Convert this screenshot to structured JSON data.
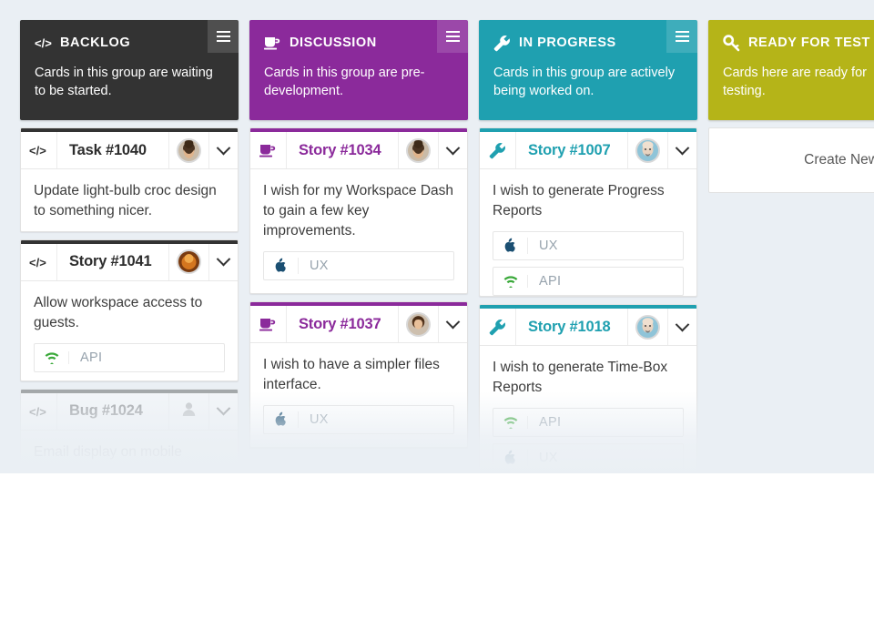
{
  "board": {
    "background_color": "#eaeff4",
    "columns": [
      {
        "id": "backlog",
        "title": "BACKLOG",
        "description": "Cards in this group are waiting to be started.",
        "color": "#333333",
        "icon": "code-icon",
        "menu_icon": "hamburger-icon",
        "cards": [
          {
            "icon": "code-icon",
            "title": "Task #1040",
            "avatar": "avatar-beard-man",
            "chevron": "chevron-down-icon",
            "text": "Update light-bulb croc design to something nicer.",
            "tags": []
          },
          {
            "icon": "code-icon",
            "title": "Story #1041",
            "avatar": "avatar-orange-person",
            "chevron": "chevron-down-icon",
            "text": "Allow workspace access to guests.",
            "tags": [
              {
                "label": "API",
                "icon": "wifi-icon",
                "color": "#3aa93a"
              }
            ]
          },
          {
            "icon": "code-icon",
            "title": "Bug #1024",
            "avatar": "user-placeholder-icon",
            "chevron": "chevron-down-icon",
            "text": "Email display on mobile",
            "tags": []
          }
        ]
      },
      {
        "id": "discussion",
        "title": "DISCUSSION",
        "description": "Cards in this group are pre-development.",
        "color": "#8b2a9b",
        "icon": "coffee-cup-icon",
        "menu_icon": "hamburger-icon",
        "cards": [
          {
            "icon": "coffee-cup-icon",
            "title": "Story #1034",
            "avatar": "avatar-beard-man",
            "chevron": "chevron-down-icon",
            "text": "I wish for my Workspace Dash to gain a few key improvements.",
            "tags": [
              {
                "label": "UX",
                "icon": "apple-icon",
                "color": "#1b4f72"
              }
            ]
          },
          {
            "icon": "coffee-cup-icon",
            "title": "Story #1037",
            "avatar": "avatar-woman",
            "chevron": "chevron-down-icon",
            "text": "I wish to have a simpler files interface.",
            "tags": [
              {
                "label": "UX",
                "icon": "apple-icon",
                "color": "#1b4f72"
              }
            ]
          }
        ]
      },
      {
        "id": "in-progress",
        "title": "IN PROGRESS",
        "description": "Cards in this group are actively being worked on.",
        "color": "#1fa0b0",
        "icon": "wrench-icon",
        "menu_icon": "hamburger-icon",
        "cards": [
          {
            "icon": "wrench-icon",
            "title": "Story #1007",
            "avatar": "avatar-bald-man",
            "chevron": "chevron-down-icon",
            "text": "I wish to generate Progress Reports",
            "tags": [
              {
                "label": "UX",
                "icon": "apple-icon",
                "color": "#1b4f72"
              },
              {
                "label": "API",
                "icon": "wifi-icon",
                "color": "#3aa93a"
              }
            ]
          },
          {
            "icon": "wrench-icon",
            "title": "Story #1018",
            "avatar": "avatar-bald-man",
            "chevron": "chevron-down-icon",
            "text": "I wish to generate Time-Box Reports",
            "tags": [
              {
                "label": "API",
                "icon": "wifi-icon",
                "color": "#3aa93a"
              },
              {
                "label": "UX",
                "icon": "apple-icon",
                "color": "#1b4f72"
              }
            ]
          }
        ]
      },
      {
        "id": "ready-for-test",
        "title": "READY FOR TEST",
        "description": "Cards here are ready for testing.",
        "color": "#b5b418",
        "icon": "key-icon",
        "menu_icon": "hamburger-icon",
        "create_card_label": "Create New Card",
        "cards": []
      }
    ]
  }
}
